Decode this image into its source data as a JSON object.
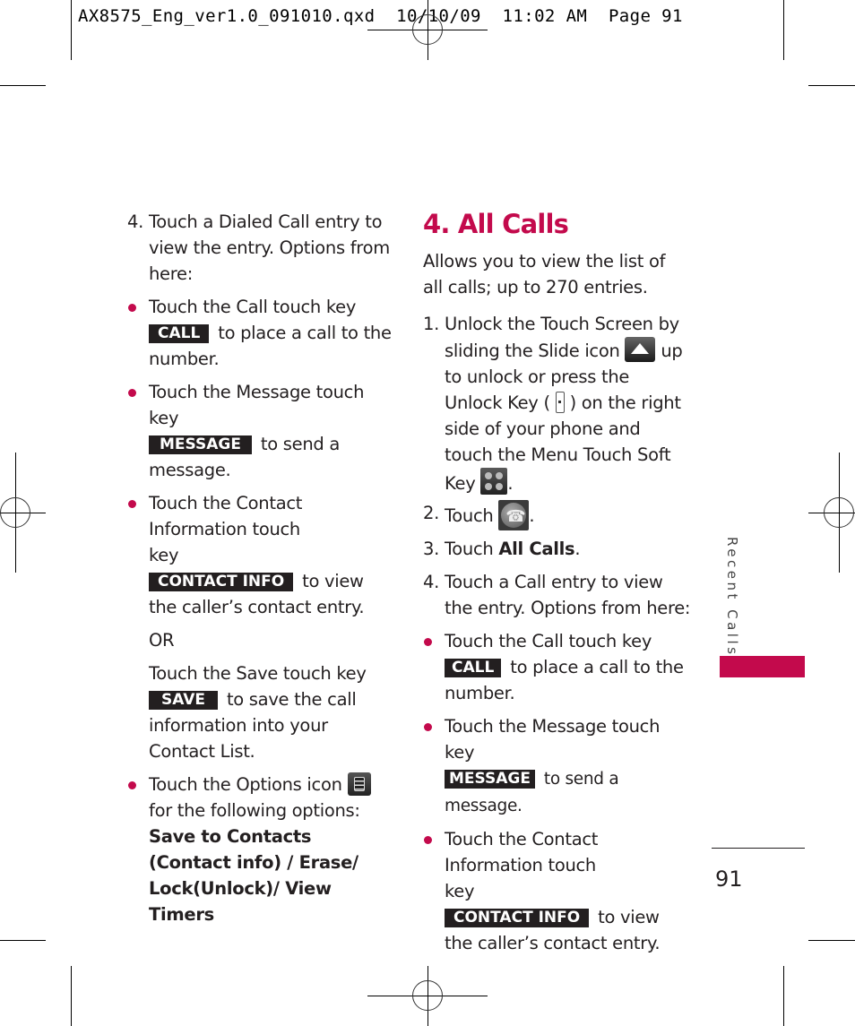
{
  "slug_line": "AX8575_Eng_ver1.0_091010.qxd  10/10/09  11:02 AM  Page 91",
  "colors": {
    "accent": "#c30a4c",
    "key_bg": "#231f20",
    "text": "#231f20"
  },
  "left_column": {
    "step4": {
      "number": "4.",
      "text": "Touch a Dialed Call entry to view the entry. Options from here:"
    },
    "bullets": [
      {
        "pre": "Touch the Call touch key",
        "key": "CALL",
        "post": "to place a call to the number."
      },
      {
        "pre": "Touch the Message touch key",
        "key": "MESSAGE",
        "post": "to send a message."
      },
      {
        "pre": "Touch the Contact Information touch key",
        "key": "CONTACT INFO",
        "post": "to view the caller’s contact entry."
      }
    ],
    "or_label": "OR",
    "save": {
      "pre": "Touch the Save touch key",
      "key": "SAVE",
      "post": "to save the call information into your Contact List."
    },
    "options": {
      "pre": "Touch the Options icon",
      "icon": "options-icon",
      "post": "for the following options:",
      "bold": "Save to Contacts (Contact info) / Erase/ Lock(Unlock)/ View Timers"
    }
  },
  "right_column": {
    "heading": "4. All Calls",
    "intro": "Allows you to view the list of all calls; up to 270 entries.",
    "steps": [
      {
        "number": "1.",
        "t1": "Unlock the Touch Screen by sliding the Slide icon",
        "icon1": "slide-icon",
        "t2": "up to unlock or press the Unlock Key (",
        "icon2": "unlock-key-icon",
        "t3": ") on the right side of your phone and touch the Menu Touch Soft Key",
        "icon3": "menu-icon",
        "t4": "."
      },
      {
        "number": "2.",
        "t1": "Touch",
        "icon1": "call-log-icon",
        "t2": "."
      },
      {
        "number": "3.",
        "t1": "Touch",
        "bold": "All Calls",
        "t2": "."
      },
      {
        "number": "4.",
        "t1": "Touch a Call entry to view the entry. Options from here:"
      }
    ],
    "bullets": [
      {
        "pre": "Touch the Call touch key",
        "key": "CALL",
        "post": "to place a call to the number."
      },
      {
        "pre": "Touch the Message touch key",
        "key": "MESSAGE",
        "post": "to send a message."
      },
      {
        "pre": "Touch the Contact Information touch key",
        "key": "CONTACT INFO",
        "post": "to view the caller’s contact entry."
      }
    ]
  },
  "side_tab": {
    "label": "Recent Calls"
  },
  "page_number": "91"
}
